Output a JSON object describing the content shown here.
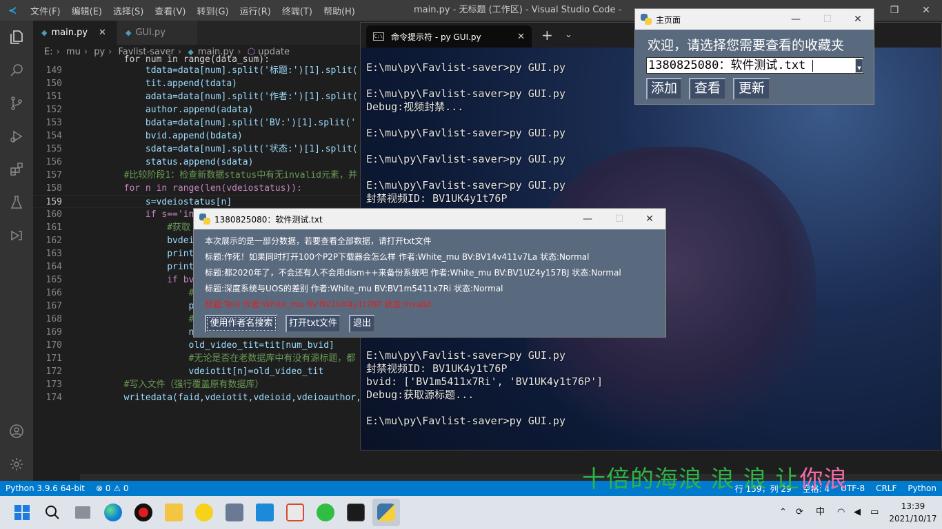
{
  "vscode": {
    "menu": [
      "文件(F)",
      "编辑(E)",
      "选择(S)",
      "查看(V)",
      "转到(G)",
      "运行(R)",
      "终端(T)",
      "帮助(H)"
    ],
    "window_title": "main.py - 无标题 (工作区) - Visual Studio Code -",
    "tabs": [
      {
        "label": "main.py",
        "active": true
      },
      {
        "label": "GUI.py",
        "active": false
      }
    ],
    "breadcrumb": [
      "E:",
      "mu",
      "py",
      "Favlist-saver",
      "main.py",
      "update"
    ],
    "code_lines": [
      {
        "ln": "149",
        "text": "            tdata=data[num].split('标题:')[1].split('",
        "kind": "normal"
      },
      {
        "ln": "150",
        "text": "            tit.append(tdata)",
        "kind": "normal"
      },
      {
        "ln": "151",
        "text": "            adata=data[num].split('作者:')[1].split('",
        "kind": "normal"
      },
      {
        "ln": "152",
        "text": "            author.append(adata)",
        "kind": "normal"
      },
      {
        "ln": "153",
        "text": "            bdata=data[num].split('BV:')[1].split(' 状",
        "kind": "normal"
      },
      {
        "ln": "154",
        "text": "            bvid.append(bdata)",
        "kind": "normal"
      },
      {
        "ln": "155",
        "text": "            sdata=data[num].split('状态:')[1].split('",
        "kind": "normal"
      },
      {
        "ln": "156",
        "text": "            status.append(sdata)",
        "kind": "normal"
      },
      {
        "ln": "157",
        "text": "        #比较阶段1：检查新数据status中有无invalid元素，并",
        "kind": "comment"
      },
      {
        "ln": "158",
        "text": "        for n in range(len(vdeiostatus)):",
        "kind": "for"
      },
      {
        "ln": "159",
        "text": "            s=vdeiostatus[n]",
        "kind": "normal"
      },
      {
        "ln": "160",
        "text": "            if s=='in",
        "kind": "if"
      },
      {
        "ln": "161",
        "text": "                #获取",
        "kind": "comment"
      },
      {
        "ln": "162",
        "text": "                bvdei",
        "kind": "normal"
      },
      {
        "ln": "163",
        "text": "                print",
        "kind": "normal"
      },
      {
        "ln": "164",
        "text": "                print",
        "kind": "normal"
      },
      {
        "ln": "165",
        "text": "                if bvd",
        "kind": "if"
      },
      {
        "ln": "166",
        "text": "                    #",
        "kind": "comment"
      },
      {
        "ln": "167",
        "text": "                    pr",
        "kind": "normal"
      },
      {
        "ln": "168",
        "text": "                    #",
        "kind": "comment"
      },
      {
        "ln": "169",
        "text": "                    nu",
        "kind": "normal"
      },
      {
        "ln": "170",
        "text": "                    old_video_tit=tit[num_bvid]",
        "kind": "normal"
      },
      {
        "ln": "171",
        "text": "                    #无论是否在老数据库中有没有源标题，都",
        "kind": "comment"
      },
      {
        "ln": "172",
        "text": "                    vdeiotit[n]=old_video_tit",
        "kind": "normal"
      },
      {
        "ln": "173",
        "text": "        #写入文件（强行覆盖原有数据库）",
        "kind": "comment"
      },
      {
        "ln": "174",
        "text": "        writedata(faid,vdeiotit,vdeioid,vdeioauthor,v",
        "kind": "normal"
      }
    ],
    "top_partial_line": "        for num in range(data_sum):",
    "status_left": [
      "Python 3.9.6 64-bit",
      "⊗ 0 ⚠ 0"
    ],
    "status_right": [
      "行 159，列 29",
      "空格: 4",
      "UTF-8",
      "CRLF",
      "Python"
    ]
  },
  "terminal": {
    "tab_title": "命令提示符 - py  GUI.py",
    "lines": [
      "E:\\mu\\py\\Favlist-saver>py GUI.py",
      "",
      "E:\\mu\\py\\Favlist-saver>py GUI.py",
      "Debug:视频封禁...",
      "",
      "E:\\mu\\py\\Favlist-saver>py GUI.py",
      "",
      "E:\\mu\\py\\Favlist-saver>py GUI.py",
      "",
      "E:\\mu\\py\\Favlist-saver>py GUI.py",
      "封禁视频ID: BV1UK4y1t76P",
      "",
      "",
      "",
      "",
      "",
      "",
      "",
      "",
      "",
      "",
      "",
      "E:\\mu\\py\\Favlist-saver>py GUI.py",
      "封禁视频ID: BV1UK4y1t76P",
      "bvid: ['BV1m5411x7Ri', 'BV1UK4y1t76P']",
      "Debug:获取源标题...",
      "",
      "E:\\mu\\py\\Favlist-saver>py GUI.py"
    ]
  },
  "main_window": {
    "title": "主页面",
    "prompt": "欢迎，请选择您需要查看的收藏夹",
    "combo_value": "1380825080：软件测试.txt",
    "buttons": [
      "添加",
      "查看",
      "更新"
    ]
  },
  "detail_window": {
    "title": "1380825080：软件测试.txt",
    "intro": "本次展示的是一部分数据，若要查看全部数据，请打开txt文件",
    "rows": [
      {
        "text": "标题:作死！如果同时打开100个P2P下载器会怎么样 作者:White_mu BV:BV14v411v7La 状态:Normal",
        "invalid": false
      },
      {
        "text": "标题:都2020年了，不会还有人不会用dism++来备份系统吧 作者:White_mu BV:BV1UZ4y157BJ 状态:Normal",
        "invalid": false
      },
      {
        "text": "标题:深度系统与UOS的差别 作者:White_mu BV:BV1m5411x7Ri 状态:Normal",
        "invalid": false
      },
      {
        "text": "标题:Test 作者:White_mu BV:BV1UK4y1t76P 状态:invalid",
        "invalid": true
      }
    ],
    "buttons": [
      "使用作者名搜索",
      "打开txt文件",
      "退出"
    ]
  },
  "lyrics": {
    "green": "十倍的海浪 浪 浪 让",
    "pink": "你浪"
  },
  "taskbar": {
    "tray_ime": "中",
    "time": "13:39",
    "date": "2021/10/17"
  }
}
